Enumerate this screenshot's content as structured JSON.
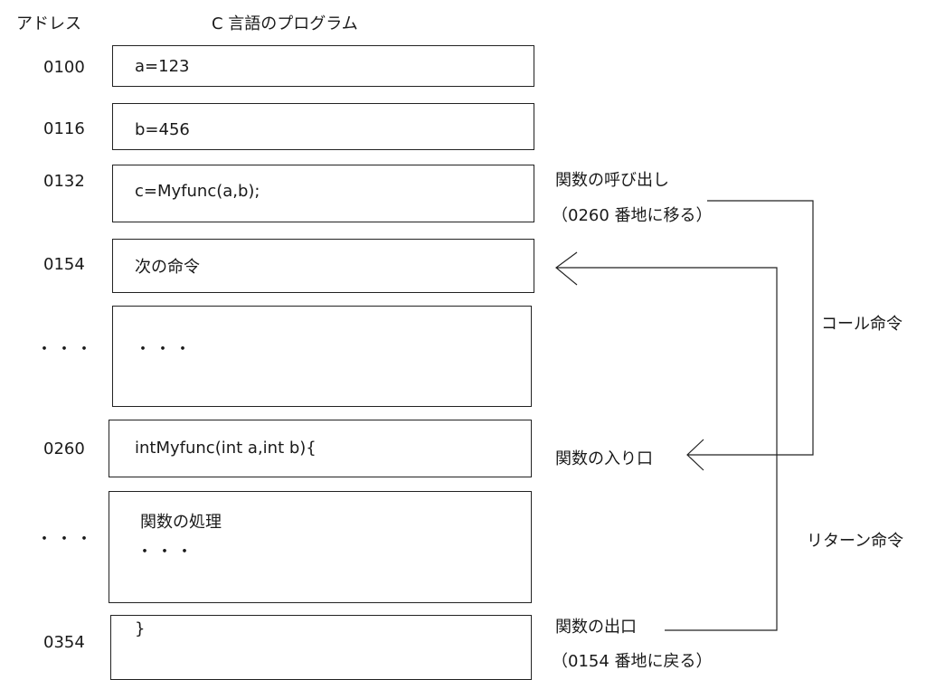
{
  "headers": {
    "address": "アドレス",
    "program": "C 言語のプログラム"
  },
  "rows": [
    {
      "address": "0100",
      "code": "a=123"
    },
    {
      "address": "0116",
      "code": "b=456"
    },
    {
      "address": "0132",
      "code": "c=Myfunc(a,b);"
    },
    {
      "address": "0154",
      "code": "次の命令"
    },
    {
      "address": "・・・",
      "code": "・・・"
    },
    {
      "address": "0260",
      "code": "intMyfunc(int a,int b){"
    },
    {
      "address": "・・・",
      "code": "関数の処理",
      "code2": "・・・"
    },
    {
      "address": "0354",
      "code": "}"
    }
  ],
  "annotations": {
    "call_line1": "関数の呼び出し",
    "call_line2": "（0260 番地に移る）",
    "call_label": "コール命令",
    "entry": "関数の入り口",
    "return_label": "リターン命令",
    "exit_line1": "関数の出口",
    "exit_line2": "（0154 番地に戻る）"
  }
}
